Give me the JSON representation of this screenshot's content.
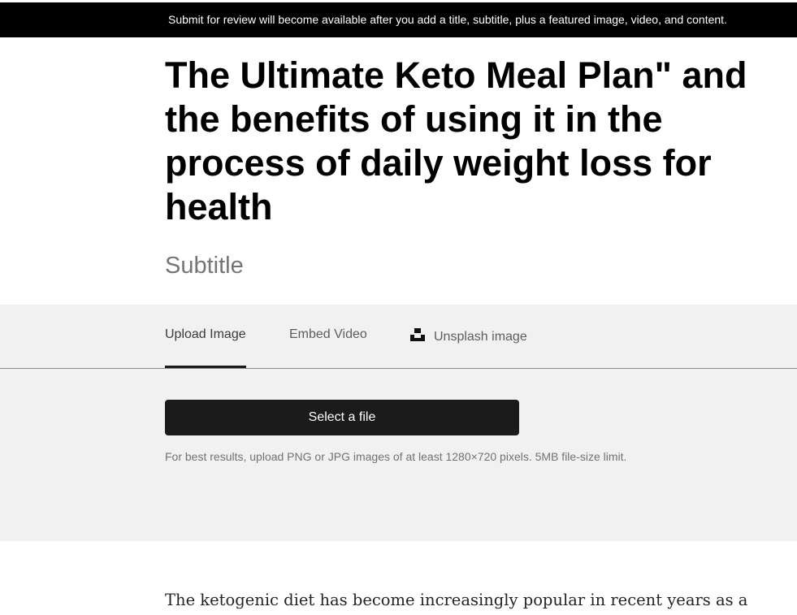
{
  "banner": {
    "text": "Submit for review will become available after you add a title, subtitle, plus a featured image, video, and content."
  },
  "post": {
    "title": "The Ultimate Keto Meal Plan\" and the benefits of using it in the process of daily weight loss for health",
    "subtitle_placeholder": "Subtitle",
    "body_text": "The ketogenic diet has become increasingly popular in recent years as a"
  },
  "media": {
    "tabs": [
      {
        "label": "Upload Image",
        "active": true
      },
      {
        "label": "Embed Video",
        "active": false
      },
      {
        "label": "Unsplash image",
        "active": false,
        "icon": "unsplash-icon"
      }
    ],
    "select_file_label": "Select a file",
    "hint": "For best results, upload PNG or JPG images of at least 1280×720 pixels. 5MB file-size limit."
  },
  "colors": {
    "banner_bg": "#000000",
    "media_bg": "#f1f1f1",
    "button_bg": "#1b1b1b",
    "subtitle_placeholder": "#757575"
  }
}
